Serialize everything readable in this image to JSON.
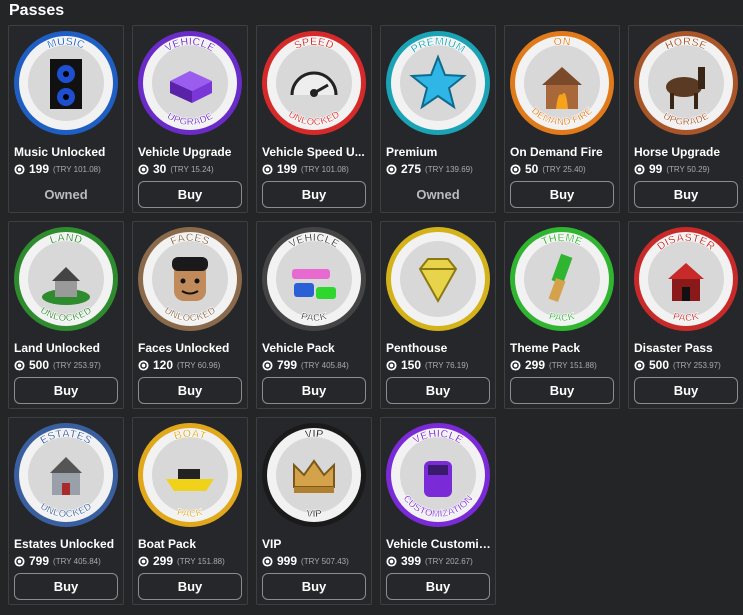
{
  "title": "Passes",
  "items": [
    {
      "name": "Music Unlocked",
      "price": "199",
      "try": "(TRY 101.08)",
      "status": "Owned",
      "ring_color": "#1f5fc4",
      "badge_top": "MUSIC",
      "badge_bottom": "",
      "icon": "speaker-icon"
    },
    {
      "name": "Vehicle Upgrade",
      "price": "30",
      "try": "(TRY 15.24)",
      "status": "Buy",
      "ring_color": "#6a2bc8",
      "badge_top": "VEHICLE",
      "badge_bottom": "UPGRADE",
      "icon": "box-icon"
    },
    {
      "name": "Vehicle Speed U...",
      "price": "199",
      "try": "(TRY 101.08)",
      "status": "Buy",
      "ring_color": "#d62a2a",
      "badge_top": "SPEED",
      "badge_bottom": "UNLOCKED",
      "icon": "speedometer-icon"
    },
    {
      "name": "Premium",
      "price": "275",
      "try": "(TRY 139.69)",
      "status": "Owned",
      "ring_color": "#1aa3b5",
      "badge_top": "PREMIUM",
      "badge_bottom": "",
      "icon": "star-icon"
    },
    {
      "name": "On Demand Fire",
      "price": "50",
      "try": "(TRY 25.40)",
      "status": "Buy",
      "ring_color": "#e07a1a",
      "badge_top": "ON",
      "badge_bottom": "DEMAND FIRE",
      "icon": "burning-house-icon"
    },
    {
      "name": "Horse Upgrade",
      "price": "99",
      "try": "(TRY 50.29)",
      "status": "Buy",
      "ring_color": "#a8552a",
      "badge_top": "HORSE",
      "badge_bottom": "UPGRADE",
      "icon": "horse-icon"
    },
    {
      "name": "Land Unlocked",
      "price": "500",
      "try": "(TRY 253.97)",
      "status": "Buy",
      "ring_color": "#2e8b2e",
      "badge_top": "LAND",
      "badge_bottom": "UNLOCKED",
      "icon": "house-icon"
    },
    {
      "name": "Faces Unlocked",
      "price": "120",
      "try": "(TRY 60.96)",
      "status": "Buy",
      "ring_color": "#8a6a4a",
      "badge_top": "FACES",
      "badge_bottom": "UNLOCKED",
      "icon": "face-icon"
    },
    {
      "name": "Vehicle Pack",
      "price": "799",
      "try": "(TRY 405.84)",
      "status": "Buy",
      "ring_color": "#444444",
      "badge_top": "VEHICLE",
      "badge_bottom": "PACK",
      "icon": "cars-icon"
    },
    {
      "name": "Penthouse",
      "price": "150",
      "try": "(TRY 76.19)",
      "status": "Buy",
      "ring_color": "#d4b21a",
      "badge_top": "",
      "badge_bottom": "",
      "icon": "diamond-icon"
    },
    {
      "name": "Theme Pack",
      "price": "299",
      "try": "(TRY 151.88)",
      "status": "Buy",
      "ring_color": "#2fb52f",
      "badge_top": "THEME",
      "badge_bottom": "PACK",
      "icon": "paintbrush-icon"
    },
    {
      "name": "Disaster Pass",
      "price": "500",
      "try": "(TRY 253.97)",
      "status": "Buy",
      "ring_color": "#c82a2a",
      "badge_top": "DISASTER",
      "badge_bottom": "PACK",
      "icon": "broken-house-icon"
    },
    {
      "name": "Estates Unlocked",
      "price": "799",
      "try": "(TRY 405.84)",
      "status": "Buy",
      "ring_color": "#3a5fa0",
      "badge_top": "ESTATES",
      "badge_bottom": "UNLOCKED",
      "icon": "mansion-icon"
    },
    {
      "name": "Boat Pack",
      "price": "299",
      "try": "(TRY 151.88)",
      "status": "Buy",
      "ring_color": "#e0a81a",
      "badge_top": "BOAT",
      "badge_bottom": "PACK",
      "icon": "boat-icon"
    },
    {
      "name": "VIP",
      "price": "999",
      "try": "(TRY 507.43)",
      "status": "Buy",
      "ring_color": "#1a1a1a",
      "badge_top": "VIP",
      "badge_bottom": "VIP",
      "icon": "crown-icon"
    },
    {
      "name": "Vehicle Customiz...",
      "price": "399",
      "try": "(TRY 202.67)",
      "status": "Buy",
      "ring_color": "#7a2ad6",
      "badge_top": "VEHICLE",
      "badge_bottom": "CUSTOMIZATION",
      "icon": "car-icon"
    }
  ]
}
